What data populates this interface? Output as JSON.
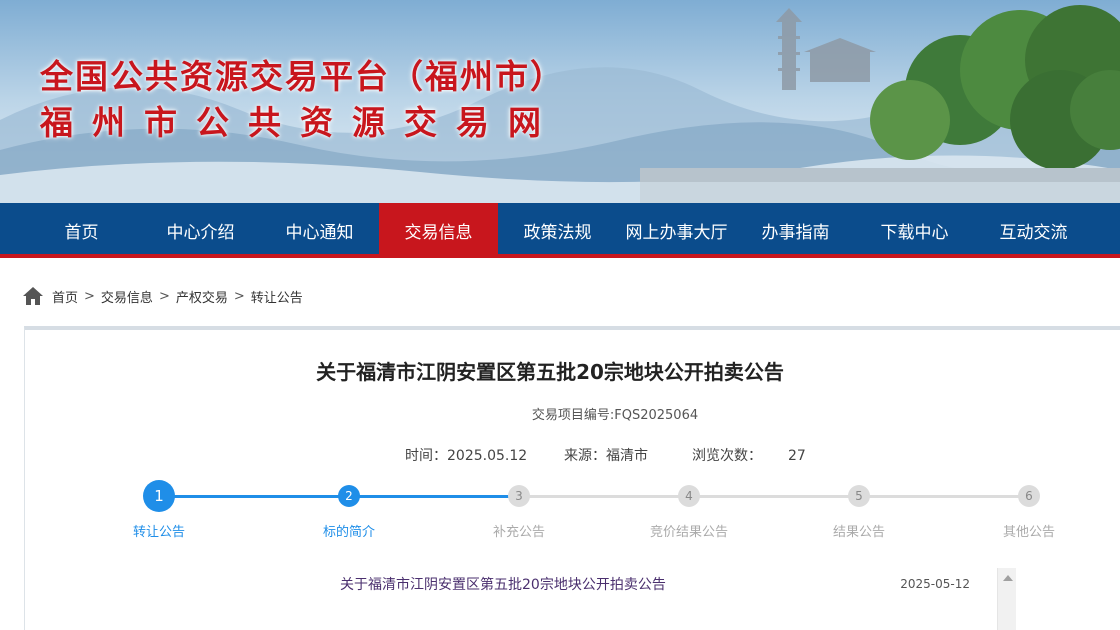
{
  "banner": {
    "title_line1": "全国公共资源交易平台（福州市）",
    "title_line2": "福州市公共资源交易网"
  },
  "nav": {
    "items": [
      {
        "label": "首页"
      },
      {
        "label": "中心介绍"
      },
      {
        "label": "中心通知"
      },
      {
        "label": "交易信息",
        "active": true
      },
      {
        "label": "政策法规"
      },
      {
        "label": "网上办事大厅"
      },
      {
        "label": "办事指南"
      },
      {
        "label": "下载中心"
      },
      {
        "label": "互动交流"
      }
    ]
  },
  "breadcrumb": {
    "items": [
      "首页",
      "交易信息",
      "产权交易",
      "转让公告"
    ],
    "separator": ">"
  },
  "article": {
    "title": "关于福清市江阴安置区第五批20宗地块公开拍卖公告",
    "project_code": "交易项目编号:FQS2025064",
    "time_label": "时间：",
    "time_value": "2025.05.12",
    "source_label": "来源：",
    "source_value": "福清市",
    "views_label": "浏览次数：",
    "views_value": "27"
  },
  "steps": {
    "items": [
      {
        "num": "1",
        "label": "转让公告",
        "active": true
      },
      {
        "num": "2",
        "label": "标的简介",
        "active": true
      },
      {
        "num": "3",
        "label": "补充公告",
        "active": false
      },
      {
        "num": "4",
        "label": "竞价结果公告",
        "active": false
      },
      {
        "num": "5",
        "label": "结果公告",
        "active": false
      },
      {
        "num": "6",
        "label": "其他公告",
        "active": false
      }
    ]
  },
  "list": {
    "rows": [
      {
        "title": "关于福清市江阴安置区第五批20宗地块公开拍卖公告",
        "date": "2025-05-12"
      }
    ]
  },
  "colors": {
    "nav_bg": "#0b4c8c",
    "accent_red": "#c8161d",
    "step_active": "#1f8ee8"
  }
}
